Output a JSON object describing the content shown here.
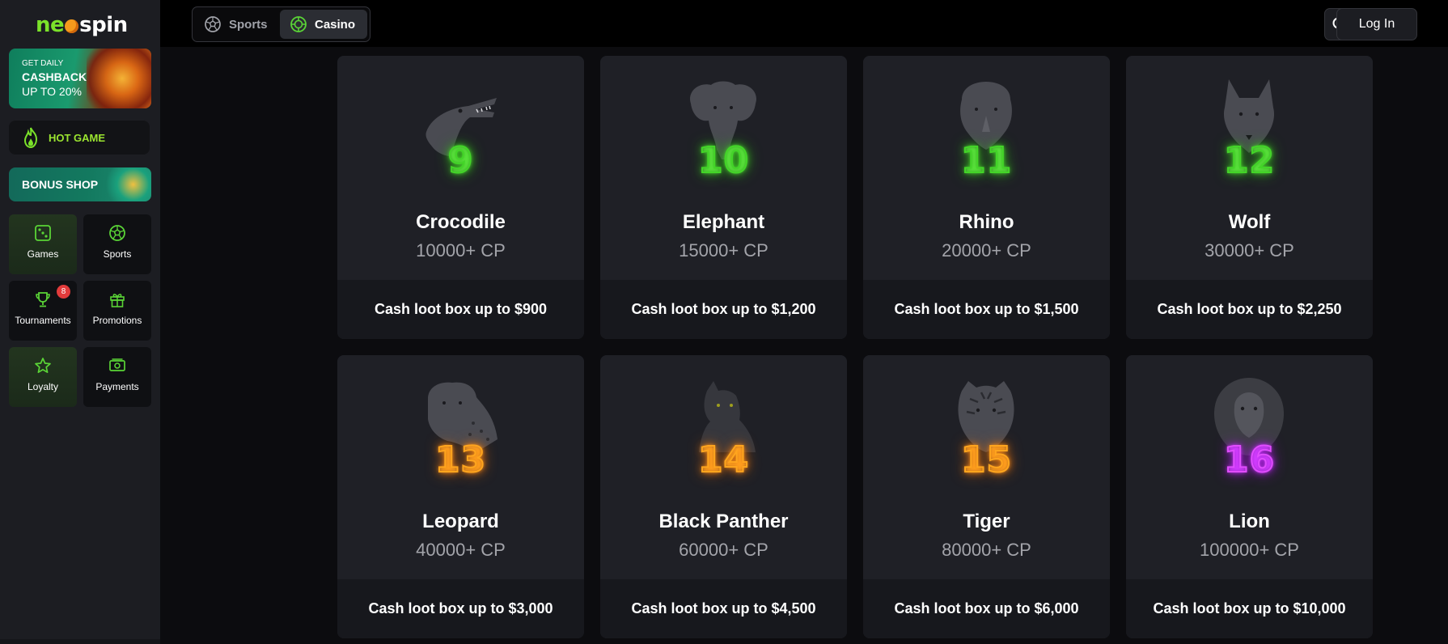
{
  "brand": {
    "name_part1": "ne",
    "name_part2": "spin",
    "accent": "#7be22a"
  },
  "sidebar": {
    "cashback_banner": {
      "line1": "GET DAILY",
      "line2": "CASHBACK",
      "line3": "UP TO 20%"
    },
    "hot_game": {
      "label": "HOT GAME"
    },
    "bonus_shop": {
      "label": "BONUS SHOP"
    },
    "nav": [
      {
        "label": "Games",
        "icon": "dice-icon"
      },
      {
        "label": "Sports",
        "icon": "soccer-ball-icon"
      },
      {
        "label": "Tournaments",
        "icon": "trophy-icon",
        "badge": "8"
      },
      {
        "label": "Promotions",
        "icon": "gift-icon"
      },
      {
        "label": "Loyalty",
        "icon": "star-icon"
      },
      {
        "label": "Payments",
        "icon": "cash-icon"
      }
    ]
  },
  "topbar": {
    "tabs": [
      {
        "label": "Sports",
        "icon": "soccer-ball-icon",
        "active": false
      },
      {
        "label": "Casino",
        "icon": "casino-chip-icon",
        "active": true
      }
    ],
    "search_icon": "search-icon",
    "login_label": "Log In"
  },
  "levels": [
    {
      "level": "9",
      "name": "Crocodile",
      "points": "10000+ CP",
      "reward": "Cash loot box up to $900",
      "glow": "green",
      "animal_icon": "crocodile-icon"
    },
    {
      "level": "10",
      "name": "Elephant",
      "points": "15000+ CP",
      "reward": "Cash loot box up to $1,200",
      "glow": "green",
      "animal_icon": "elephant-icon"
    },
    {
      "level": "11",
      "name": "Rhino",
      "points": "20000+ CP",
      "reward": "Cash loot box up to $1,500",
      "glow": "green",
      "animal_icon": "rhino-icon"
    },
    {
      "level": "12",
      "name": "Wolf",
      "points": "30000+ CP",
      "reward": "Cash loot box up to $2,250",
      "glow": "green",
      "animal_icon": "wolf-icon"
    },
    {
      "level": "13",
      "name": "Leopard",
      "points": "40000+ CP",
      "reward": "Cash loot box up to $3,000",
      "glow": "orange",
      "animal_icon": "leopard-icon"
    },
    {
      "level": "14",
      "name": "Black Panther",
      "points": "60000+ CP",
      "reward": "Cash loot box up to $4,500",
      "glow": "orange",
      "animal_icon": "panther-icon"
    },
    {
      "level": "15",
      "name": "Tiger",
      "points": "80000+ CP",
      "reward": "Cash loot box up to $6,000",
      "glow": "orange",
      "animal_icon": "tiger-icon"
    },
    {
      "level": "16",
      "name": "Lion",
      "points": "100000+ CP",
      "reward": "Cash loot box up to $10,000",
      "glow": "purple",
      "animal_icon": "lion-icon"
    }
  ]
}
